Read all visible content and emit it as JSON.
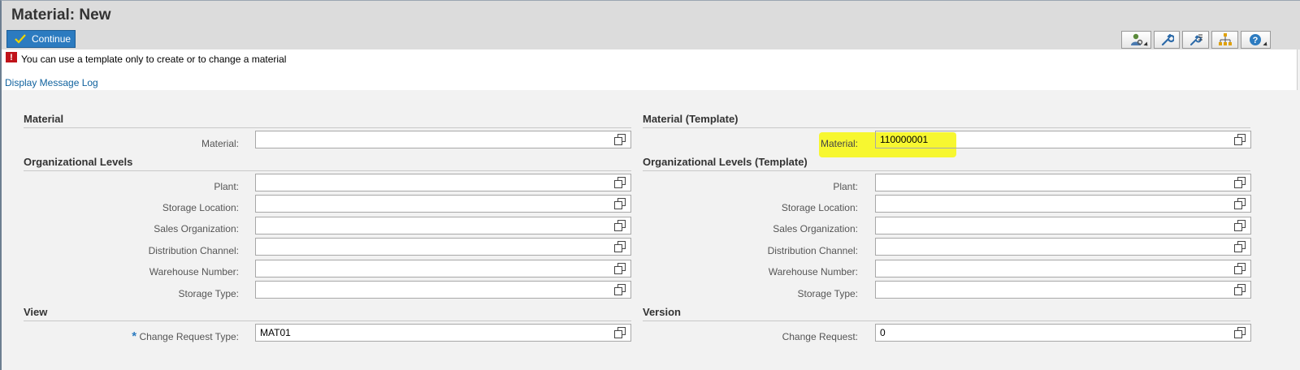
{
  "header": {
    "title": "Material: New",
    "continue_label": "Continue"
  },
  "message": {
    "text": "You can use a template only to create or to change a material",
    "log_link": "Display Message Log"
  },
  "left": {
    "material_section": "Material",
    "material_label": "Material:",
    "material_value": "",
    "org_section": "Organizational Levels",
    "plant_label": "Plant:",
    "storage_location_label": "Storage Location:",
    "sales_org_label": "Sales Organization:",
    "distribution_channel_label": "Distribution Channel:",
    "warehouse_number_label": "Warehouse Number:",
    "storage_type_label": "Storage Type:",
    "view_section": "View",
    "required_marker": "*",
    "change_request_type_label": "Change Request Type:",
    "change_request_type_value": "MAT01"
  },
  "right": {
    "material_section": "Material (Template)",
    "material_label": "Material:",
    "material_value": "110000001",
    "org_section": "Organizational Levels (Template)",
    "plant_label": "Plant:",
    "storage_location_label": "Storage Location:",
    "sales_org_label": "Sales Organization:",
    "distribution_channel_label": "Distribution Channel:",
    "warehouse_number_label": "Warehouse Number:",
    "storage_type_label": "Storage Type:",
    "version_section": "Version",
    "change_request_label": "Change Request:",
    "change_request_value": "0"
  },
  "colors": {
    "accent": "#2c7bc0",
    "highlight": "#f7f730",
    "error": "#c0131a",
    "link": "#10629e"
  },
  "icons": {
    "toolbar": [
      "personalize-icon",
      "settings-wrench-icon",
      "technical-settings-icon",
      "hierarchy-icon",
      "help-icon"
    ],
    "value_help": "value-help-icon",
    "error": "error-icon"
  }
}
